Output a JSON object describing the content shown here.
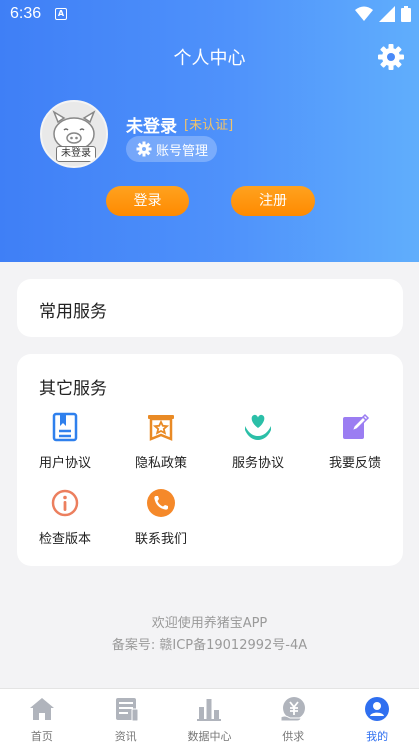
{
  "status_bar": {
    "time": "6:36",
    "notification": "A"
  },
  "header": {
    "title": "个人中心",
    "user_name": "未登录",
    "auth_status": "[未认证]",
    "avatar_tag": "未登录",
    "account_button": "账号管理",
    "login_button": "登录",
    "register_button": "注册"
  },
  "common_services": {
    "title": "常用服务"
  },
  "other_services": {
    "title": "其它服务",
    "items": [
      {
        "label": "用户协议",
        "icon": "document-icon"
      },
      {
        "label": "隐私政策",
        "icon": "star-scroll-icon"
      },
      {
        "label": "服务协议",
        "icon": "heart-hand-icon"
      },
      {
        "label": "我要反馈",
        "icon": "edit-icon"
      },
      {
        "label": "检查版本",
        "icon": "info-icon"
      },
      {
        "label": "联系我们",
        "icon": "phone-icon"
      }
    ]
  },
  "footer": {
    "welcome": "欢迎使用养猪宝APP",
    "icp": "备案号: 赣ICP备19012992号-4A"
  },
  "tabbar": {
    "items": [
      {
        "label": "首页",
        "icon": "home-icon"
      },
      {
        "label": "资讯",
        "icon": "news-icon"
      },
      {
        "label": "数据中心",
        "icon": "bar-chart-icon"
      },
      {
        "label": "供求",
        "icon": "yuan-icon"
      },
      {
        "label": "我的",
        "icon": "user-icon"
      }
    ],
    "active": "我的"
  },
  "colors": {
    "header_gradient_start": "#3f7ff6",
    "header_gradient_end": "#60aefc",
    "button_orange": "#ff9412",
    "active_tab": "#2f6ff0",
    "auth_tag": "#f0c36a"
  }
}
